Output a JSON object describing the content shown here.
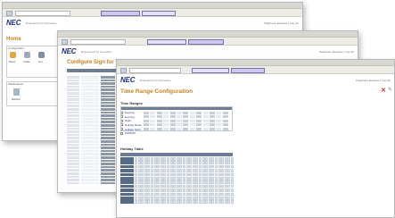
{
  "logo": "NEC",
  "window_back": {
    "header": {
      "tagline": "Empowered by Innovation",
      "right_text": "Telephone Features | Log out"
    },
    "page_title": "Home",
    "side_labels": [
      "Configuration",
      "Maintenance"
    ],
    "icon_labels": [
      "Basic",
      "Cable",
      "Net",
      "Backup"
    ]
  },
  "window_middle": {
    "header": {
      "tagline": "Empowered by Innovation",
      "right_text": "Telephone Features | Log out"
    },
    "page_title": "Configure Sign for Tenant"
  },
  "window_front": {
    "header": {
      "tagline": "Empowered by Innovation",
      "right_text": "Telephone Features | Log out"
    },
    "page_title": "Time Range Configuration",
    "time_ranges_heading": "Time Ranges",
    "holiday_table_heading": "Holiday Table",
    "range_rows": [
      "Daytime",
      "Evening",
      "Night",
      "Holiday Mode",
      "Holiday Night"
    ],
    "close_icon": "close-icon",
    "edit_icon": "pencil-icon",
    "colors": {
      "title": "#c6831f",
      "table_header": "#6d7e94",
      "row_header": "#556a86",
      "grid_cell": "#e3e8f0"
    }
  }
}
